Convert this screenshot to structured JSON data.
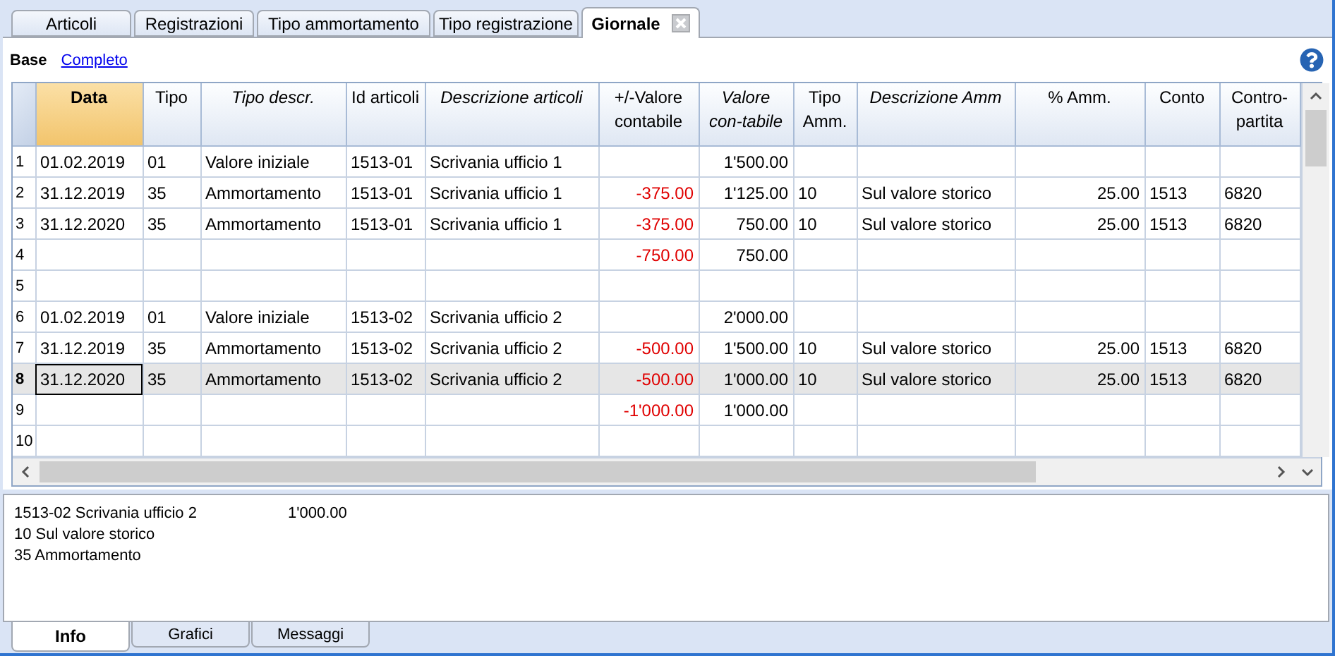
{
  "tabs": [
    {
      "label": "Articoli",
      "selected": false
    },
    {
      "label": "Registrazioni",
      "selected": false
    },
    {
      "label": "Tipo ammortamento",
      "selected": false
    },
    {
      "label": "Tipo registrazione",
      "selected": false
    },
    {
      "label": "Giornale",
      "selected": true,
      "closable": true
    }
  ],
  "views": [
    {
      "label": "Base",
      "selected": true
    },
    {
      "label": "Completo",
      "selected": false
    }
  ],
  "table": {
    "columns": [
      {
        "label": "Data",
        "italic": false,
        "numeric": false,
        "selected": true
      },
      {
        "label": "Tipo",
        "italic": false,
        "numeric": false,
        "selected": false
      },
      {
        "label": "Tipo descr.",
        "italic": true,
        "numeric": false,
        "selected": false
      },
      {
        "label": "Id articoli",
        "italic": false,
        "numeric": false,
        "selected": false
      },
      {
        "label": "Descrizione articoli",
        "italic": true,
        "numeric": false,
        "selected": false
      },
      {
        "label": "+/-Valore contabile",
        "italic": false,
        "numeric": true,
        "negative": true,
        "selected": false
      },
      {
        "label": "Valore con-tabile",
        "italic": true,
        "numeric": true,
        "selected": false
      },
      {
        "label": "Tipo Amm.",
        "italic": false,
        "numeric": false,
        "selected": false
      },
      {
        "label": "Descrizione Amm",
        "italic": true,
        "numeric": false,
        "selected": false
      },
      {
        "label": "% Amm.",
        "italic": false,
        "numeric": true,
        "selected": false
      },
      {
        "label": "Conto",
        "italic": false,
        "numeric": false,
        "selected": false
      },
      {
        "label": "Contro-partita",
        "italic": false,
        "numeric": false,
        "selected": false
      }
    ],
    "rows": [
      {
        "number": "1",
        "selected": false,
        "cells": [
          "01.02.2019",
          "01",
          "Valore iniziale",
          "1513-01",
          "Scrivania ufficio 1",
          "",
          "1'500.00",
          "",
          "",
          "",
          "",
          ""
        ]
      },
      {
        "number": "2",
        "selected": false,
        "cells": [
          "31.12.2019",
          "35",
          "Ammortamento",
          "1513-01",
          "Scrivania ufficio 1",
          "-375.00",
          "1'125.00",
          "10",
          "Sul valore storico",
          "25.00",
          "1513",
          "6820"
        ]
      },
      {
        "number": "3",
        "selected": false,
        "cells": [
          "31.12.2020",
          "35",
          "Ammortamento",
          "1513-01",
          "Scrivania ufficio 1",
          "-375.00",
          "750.00",
          "10",
          "Sul valore storico",
          "25.00",
          "1513",
          "6820"
        ]
      },
      {
        "number": "4",
        "selected": false,
        "cells": [
          "",
          "",
          "",
          "",
          "",
          "-750.00",
          "750.00",
          "",
          "",
          "",
          "",
          ""
        ]
      },
      {
        "number": "5",
        "selected": false,
        "cells": [
          "",
          "",
          "",
          "",
          "",
          "",
          "",
          "",
          "",
          "",
          "",
          ""
        ]
      },
      {
        "number": "6",
        "selected": false,
        "cells": [
          "01.02.2019",
          "01",
          "Valore iniziale",
          "1513-02",
          "Scrivania ufficio 2",
          "",
          "2'000.00",
          "",
          "",
          "",
          "",
          ""
        ]
      },
      {
        "number": "7",
        "selected": false,
        "cells": [
          "31.12.2019",
          "35",
          "Ammortamento",
          "1513-02",
          "Scrivania ufficio 2",
          "-500.00",
          "1'500.00",
          "10",
          "Sul valore storico",
          "25.00",
          "1513",
          "6820"
        ]
      },
      {
        "number": "8",
        "selected": true,
        "cells": [
          "31.12.2020",
          "35",
          "Ammortamento",
          "1513-02",
          "Scrivania ufficio 2",
          "-500.00",
          "1'000.00",
          "10",
          "Sul valore storico",
          "25.00",
          "1513",
          "6820"
        ]
      },
      {
        "number": "9",
        "selected": false,
        "cells": [
          "",
          "",
          "",
          "",
          "",
          "-1'000.00",
          "1'000.00",
          "",
          "",
          "",
          "",
          ""
        ]
      },
      {
        "number": "10",
        "selected": false,
        "cells": [
          "",
          "",
          "",
          "",
          "",
          "",
          "",
          "",
          "",
          "",
          "",
          ""
        ]
      }
    ]
  },
  "info": {
    "lines": [
      {
        "text": "1513-02 Scrivania ufficio 2",
        "amount": "1'000.00"
      },
      {
        "text": "10 Sul valore storico"
      },
      {
        "text": "35 Ammortamento"
      }
    ]
  },
  "bottom_tabs": [
    {
      "label": "Info",
      "selected": true
    },
    {
      "label": "Grafici",
      "selected": false
    },
    {
      "label": "Messaggi",
      "selected": false
    }
  ]
}
